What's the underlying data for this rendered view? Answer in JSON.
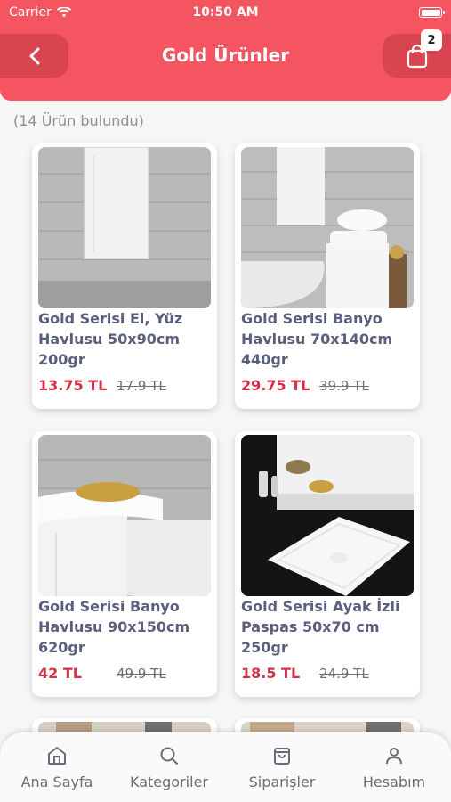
{
  "status": {
    "carrier": "Carrier",
    "time": "10:50 AM"
  },
  "header": {
    "title": "Gold Ürünler",
    "cart_count": "2"
  },
  "result_text": "(14 Ürün bulundu)",
  "products": [
    {
      "name": "Gold Serisi El, Yüz Havlusu 50x90cm 200gr",
      "price": "13.75 TL",
      "old_price": "17.9 TL"
    },
    {
      "name": "Gold Serisi Banyo Havlusu 70x140cm 440gr",
      "price": "29.75 TL",
      "old_price": "39.9 TL"
    },
    {
      "name": "Gold Serisi Banyo Havlusu 90x150cm 620gr",
      "price": "42 TL",
      "old_price": "49.9 TL"
    },
    {
      "name": "Gold Serisi Ayak İzli Paspas 50x70 cm 250gr",
      "price": "18.5 TL",
      "old_price": "24.9 TL"
    }
  ],
  "nav": [
    {
      "label": "Ana Sayfa",
      "icon": "home-icon"
    },
    {
      "label": "Kategoriler",
      "icon": "search-icon"
    },
    {
      "label": "Siparişler",
      "icon": "bag-icon"
    },
    {
      "label": "Hesabım",
      "icon": "user-icon"
    }
  ],
  "colors": {
    "brand": "#f55561",
    "brand_dark": "#d8444f",
    "price": "#d33048",
    "product_text": "#5a5f7d"
  }
}
